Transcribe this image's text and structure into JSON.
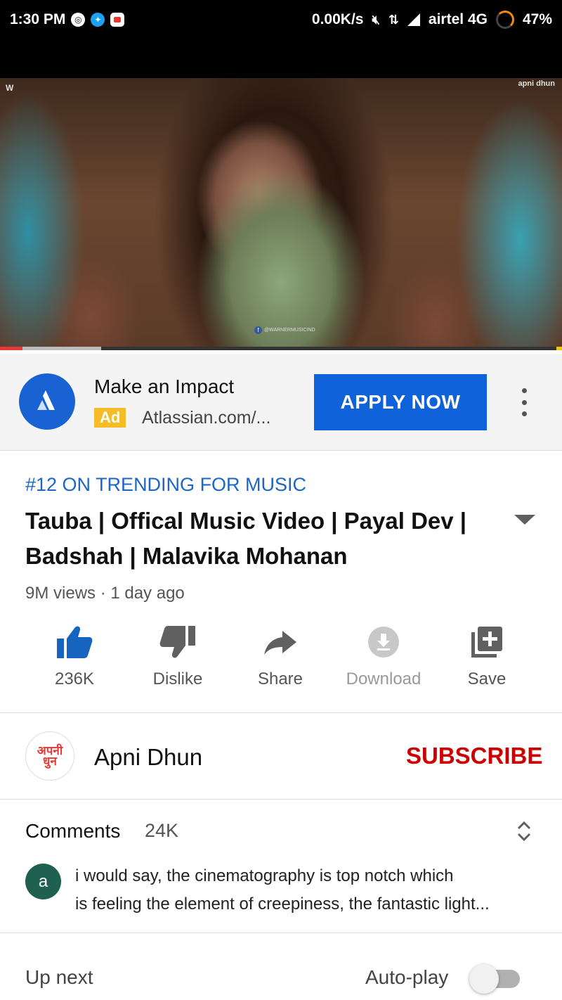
{
  "status_bar": {
    "time": "1:30 PM",
    "network_speed": "0.00K/s",
    "carrier": "airtel 4G",
    "battery": "47%"
  },
  "video": {
    "watermark_left": "W",
    "watermark_right": "apni dhun",
    "credit": "@WARNERMUSICIND",
    "progress_played": 0.04,
    "progress_buffered": 0.18
  },
  "ad": {
    "title": "Make an Impact",
    "badge": "Ad",
    "url": "Atlassian.com/...",
    "cta": "APPLY NOW",
    "brand_color": "#1862d4",
    "badge_color": "#f4bc26"
  },
  "video_info": {
    "trending": "#12 ON TRENDING FOR MUSIC",
    "title": "Tauba | Offical Music Video | Payal Dev | Badshah | Malavika Mohanan",
    "meta": "9M views · 1 day ago"
  },
  "actions": {
    "like": "236K",
    "dislike": "Dislike",
    "share": "Share",
    "download": "Download",
    "save": "Save"
  },
  "channel": {
    "avatar_text_top": "अपनी",
    "avatar_text_bottom": "धुन",
    "name": "Apni Dhun",
    "subscribe": "SUBSCRIBE"
  },
  "comments": {
    "label": "Comments",
    "count": "24K",
    "top_comment": {
      "avatar_letter": "a",
      "line1": "i would say, the cinematography is top notch which",
      "line2": "is feeling the element of creepiness, the fantastic light..."
    }
  },
  "up_next": {
    "label": "Up next",
    "autoplay_label": "Auto-play",
    "autoplay_on": false
  }
}
